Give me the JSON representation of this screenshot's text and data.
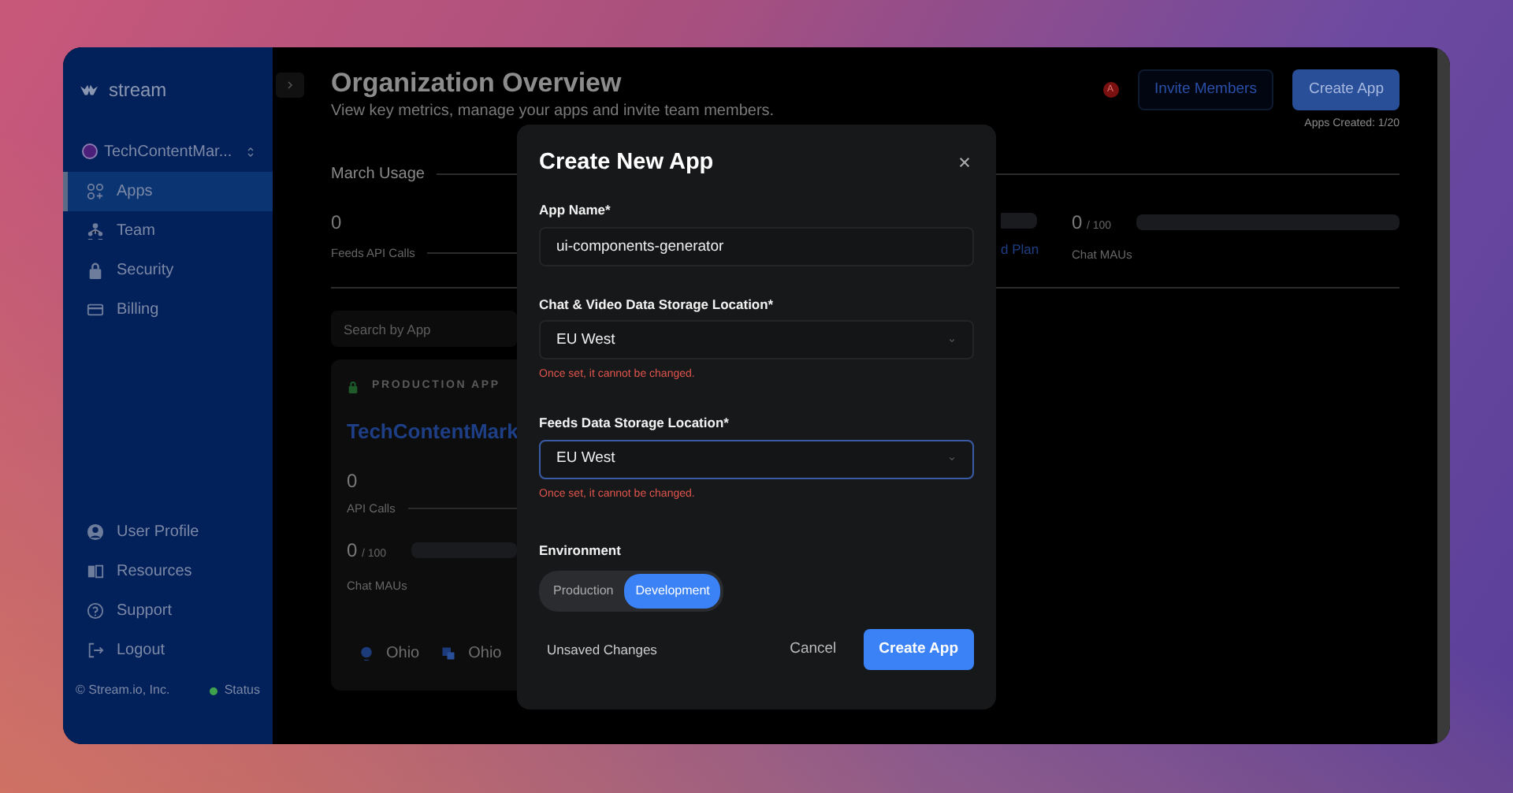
{
  "sidebar": {
    "logo": "stream",
    "org": {
      "name": "TechContentMar..."
    },
    "nav": [
      {
        "label": "Apps",
        "kind": "apps",
        "selected": true
      },
      {
        "label": "Team",
        "kind": "team",
        "selected": false
      },
      {
        "label": "Security",
        "kind": "lock",
        "selected": false
      },
      {
        "label": "Billing",
        "kind": "card",
        "selected": false
      }
    ],
    "bottom_nav": [
      {
        "label": "User Profile",
        "kind": "user"
      },
      {
        "label": "Resources",
        "kind": "book"
      },
      {
        "label": "Support",
        "kind": "help"
      },
      {
        "label": "Logout",
        "kind": "logout"
      }
    ],
    "footer": {
      "copyright": "© Stream.io, Inc.",
      "status": "Status"
    }
  },
  "header": {
    "title": "Organization Overview",
    "subtitle": "View key metrics, manage your apps and invite team members.",
    "avatar": "A",
    "invite_button": "Invite Members",
    "create_button": "Create App",
    "apps_created": "Apps Created: 1/20"
  },
  "usage": {
    "title": "March Usage",
    "feeds": {
      "value": "0",
      "label": "Feeds API Calls"
    },
    "plan_link": "d Plan",
    "chat": {
      "value": "0",
      "limit": "/ 100",
      "label": "Chat MAUs"
    }
  },
  "search": {
    "placeholder": "Search by App"
  },
  "app_card": {
    "badge": "PRODUCTION APP",
    "name": "TechContentMark",
    "api_calls": {
      "value": "0",
      "label": "API Calls"
    },
    "chat": {
      "value": "0",
      "limit": "/ 100",
      "label": "Chat MAUs"
    },
    "regions": [
      {
        "kind": "chat",
        "label": "Ohio"
      },
      {
        "kind": "feeds",
        "label": "Ohio"
      }
    ]
  },
  "modal": {
    "title": "Create New App",
    "fields": [
      {
        "kind": "text",
        "label": "App Name*",
        "value": "ui-components-generator",
        "focused": false
      },
      {
        "kind": "select",
        "label": "Chat & Video Data Storage Location*",
        "value": "EU West",
        "note": "Once set, it cannot be changed.",
        "focused": false
      },
      {
        "kind": "select",
        "label": "Feeds Data Storage Location*",
        "value": "EU West",
        "note": "Once set, it cannot be changed.",
        "focused": true
      }
    ],
    "environment": {
      "label": "Environment",
      "options": [
        {
          "label": "Production",
          "selected": false
        },
        {
          "label": "Development",
          "selected": true
        }
      ]
    },
    "status": "Unsaved Changes",
    "cancel": "Cancel",
    "submit": "Create App"
  }
}
